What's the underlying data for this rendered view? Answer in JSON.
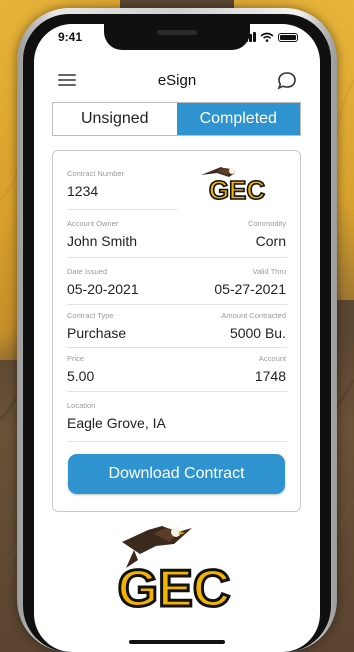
{
  "status_bar": {
    "time": "9:41"
  },
  "header": {
    "title": "eSign",
    "menu_icon": "hamburger-menu-icon",
    "chat_icon": "chat-bubble-icon"
  },
  "tabs": [
    {
      "label": "Unsigned",
      "active": false
    },
    {
      "label": "Completed",
      "active": true
    }
  ],
  "logo_text": "GEC",
  "contract": {
    "contract_number": {
      "label": "Contract Number",
      "value": "1234"
    },
    "account_owner": {
      "label": "Account Owner",
      "value": "John Smith"
    },
    "commodity": {
      "label": "Commodity",
      "value": "Corn"
    },
    "date_issued": {
      "label": "Date Issued",
      "value": "05-20-2021"
    },
    "valid_thru": {
      "label": "Valid Thru",
      "value": "05-27-2021"
    },
    "contract_type": {
      "label": "Contract Type",
      "value": "Purchase"
    },
    "amount_contracted": {
      "label": "Amount Contracted",
      "value": "5000 Bu."
    },
    "price": {
      "label": "Price",
      "value": "5.00"
    },
    "account": {
      "label": "Account",
      "value": "1748"
    },
    "location": {
      "label": "Location",
      "value": "Eagle Grove, IA"
    }
  },
  "download_button": {
    "label": "Download Contract"
  },
  "colors": {
    "accent": "#2e93cf",
    "logo_gold": "#f2b400",
    "background_gold": "#e0aa35"
  }
}
